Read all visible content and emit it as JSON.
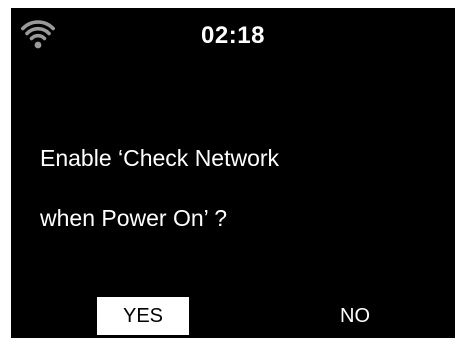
{
  "status_bar": {
    "wifi_icon": "wifi-signal-icon",
    "time": "02:18"
  },
  "dialog": {
    "line1": "Enable ‘Check Network",
    "line2": "when Power On’ ?"
  },
  "buttons": {
    "yes_label": "YES",
    "no_label": "NO",
    "selected": "YES"
  },
  "colors": {
    "background": "#000000",
    "text": "#ffffff",
    "wifi": "#9a9a9a",
    "highlight": "#ffffff"
  }
}
